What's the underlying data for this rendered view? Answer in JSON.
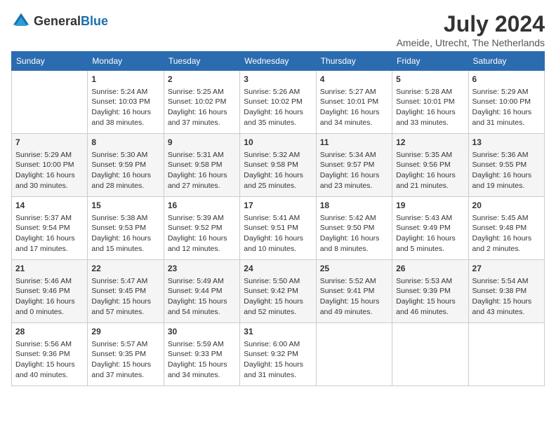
{
  "header": {
    "logo_general": "General",
    "logo_blue": "Blue",
    "title": "July 2024",
    "location": "Ameide, Utrecht, The Netherlands"
  },
  "weekdays": [
    "Sunday",
    "Monday",
    "Tuesday",
    "Wednesday",
    "Thursday",
    "Friday",
    "Saturday"
  ],
  "weeks": [
    [
      {
        "day": "",
        "info": ""
      },
      {
        "day": "1",
        "info": "Sunrise: 5:24 AM\nSunset: 10:03 PM\nDaylight: 16 hours\nand 38 minutes."
      },
      {
        "day": "2",
        "info": "Sunrise: 5:25 AM\nSunset: 10:02 PM\nDaylight: 16 hours\nand 37 minutes."
      },
      {
        "day": "3",
        "info": "Sunrise: 5:26 AM\nSunset: 10:02 PM\nDaylight: 16 hours\nand 35 minutes."
      },
      {
        "day": "4",
        "info": "Sunrise: 5:27 AM\nSunset: 10:01 PM\nDaylight: 16 hours\nand 34 minutes."
      },
      {
        "day": "5",
        "info": "Sunrise: 5:28 AM\nSunset: 10:01 PM\nDaylight: 16 hours\nand 33 minutes."
      },
      {
        "day": "6",
        "info": "Sunrise: 5:29 AM\nSunset: 10:00 PM\nDaylight: 16 hours\nand 31 minutes."
      }
    ],
    [
      {
        "day": "7",
        "info": "Sunrise: 5:29 AM\nSunset: 10:00 PM\nDaylight: 16 hours\nand 30 minutes."
      },
      {
        "day": "8",
        "info": "Sunrise: 5:30 AM\nSunset: 9:59 PM\nDaylight: 16 hours\nand 28 minutes."
      },
      {
        "day": "9",
        "info": "Sunrise: 5:31 AM\nSunset: 9:58 PM\nDaylight: 16 hours\nand 27 minutes."
      },
      {
        "day": "10",
        "info": "Sunrise: 5:32 AM\nSunset: 9:58 PM\nDaylight: 16 hours\nand 25 minutes."
      },
      {
        "day": "11",
        "info": "Sunrise: 5:34 AM\nSunset: 9:57 PM\nDaylight: 16 hours\nand 23 minutes."
      },
      {
        "day": "12",
        "info": "Sunrise: 5:35 AM\nSunset: 9:56 PM\nDaylight: 16 hours\nand 21 minutes."
      },
      {
        "day": "13",
        "info": "Sunrise: 5:36 AM\nSunset: 9:55 PM\nDaylight: 16 hours\nand 19 minutes."
      }
    ],
    [
      {
        "day": "14",
        "info": "Sunrise: 5:37 AM\nSunset: 9:54 PM\nDaylight: 16 hours\nand 17 minutes."
      },
      {
        "day": "15",
        "info": "Sunrise: 5:38 AM\nSunset: 9:53 PM\nDaylight: 16 hours\nand 15 minutes."
      },
      {
        "day": "16",
        "info": "Sunrise: 5:39 AM\nSunset: 9:52 PM\nDaylight: 16 hours\nand 12 minutes."
      },
      {
        "day": "17",
        "info": "Sunrise: 5:41 AM\nSunset: 9:51 PM\nDaylight: 16 hours\nand 10 minutes."
      },
      {
        "day": "18",
        "info": "Sunrise: 5:42 AM\nSunset: 9:50 PM\nDaylight: 16 hours\nand 8 minutes."
      },
      {
        "day": "19",
        "info": "Sunrise: 5:43 AM\nSunset: 9:49 PM\nDaylight: 16 hours\nand 5 minutes."
      },
      {
        "day": "20",
        "info": "Sunrise: 5:45 AM\nSunset: 9:48 PM\nDaylight: 16 hours\nand 2 minutes."
      }
    ],
    [
      {
        "day": "21",
        "info": "Sunrise: 5:46 AM\nSunset: 9:46 PM\nDaylight: 16 hours\nand 0 minutes."
      },
      {
        "day": "22",
        "info": "Sunrise: 5:47 AM\nSunset: 9:45 PM\nDaylight: 15 hours\nand 57 minutes."
      },
      {
        "day": "23",
        "info": "Sunrise: 5:49 AM\nSunset: 9:44 PM\nDaylight: 15 hours\nand 54 minutes."
      },
      {
        "day": "24",
        "info": "Sunrise: 5:50 AM\nSunset: 9:42 PM\nDaylight: 15 hours\nand 52 minutes."
      },
      {
        "day": "25",
        "info": "Sunrise: 5:52 AM\nSunset: 9:41 PM\nDaylight: 15 hours\nand 49 minutes."
      },
      {
        "day": "26",
        "info": "Sunrise: 5:53 AM\nSunset: 9:39 PM\nDaylight: 15 hours\nand 46 minutes."
      },
      {
        "day": "27",
        "info": "Sunrise: 5:54 AM\nSunset: 9:38 PM\nDaylight: 15 hours\nand 43 minutes."
      }
    ],
    [
      {
        "day": "28",
        "info": "Sunrise: 5:56 AM\nSunset: 9:36 PM\nDaylight: 15 hours\nand 40 minutes."
      },
      {
        "day": "29",
        "info": "Sunrise: 5:57 AM\nSunset: 9:35 PM\nDaylight: 15 hours\nand 37 minutes."
      },
      {
        "day": "30",
        "info": "Sunrise: 5:59 AM\nSunset: 9:33 PM\nDaylight: 15 hours\nand 34 minutes."
      },
      {
        "day": "31",
        "info": "Sunrise: 6:00 AM\nSunset: 9:32 PM\nDaylight: 15 hours\nand 31 minutes."
      },
      {
        "day": "",
        "info": ""
      },
      {
        "day": "",
        "info": ""
      },
      {
        "day": "",
        "info": ""
      }
    ]
  ]
}
